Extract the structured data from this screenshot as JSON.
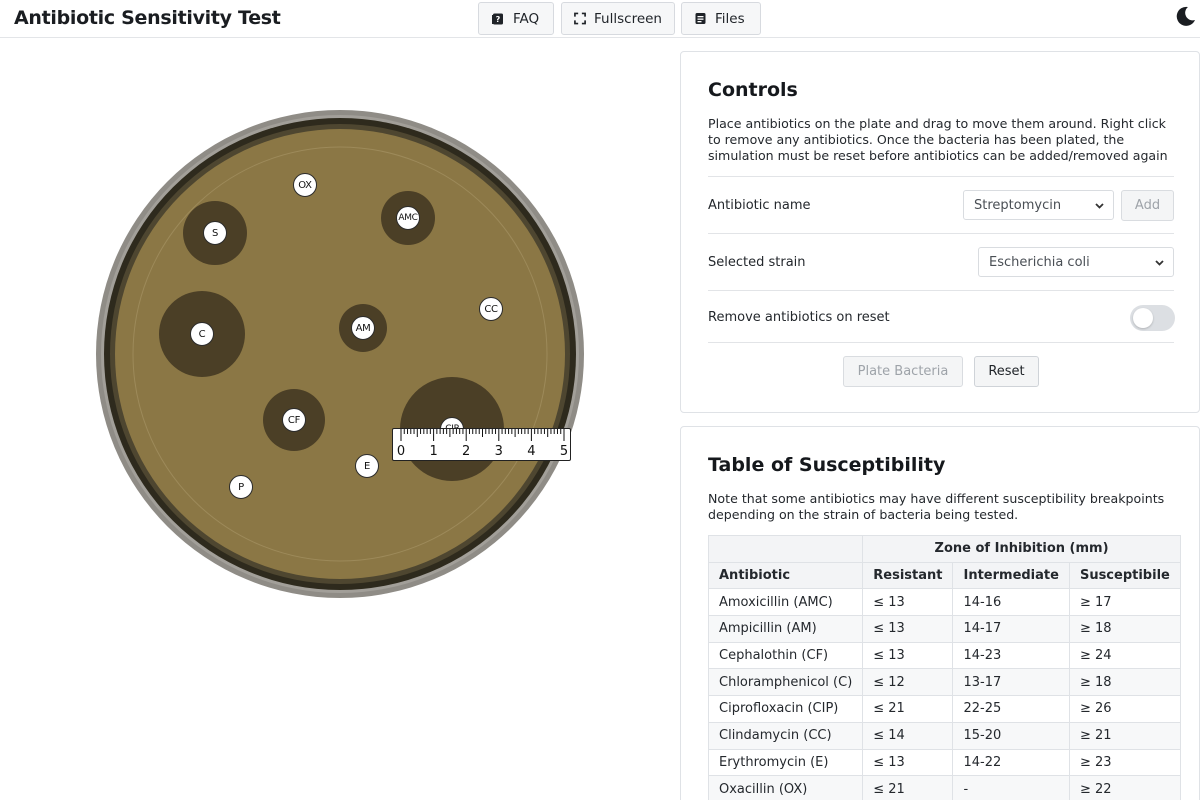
{
  "header": {
    "title": "Antibiotic Sensitivity Test",
    "faq_label": "FAQ",
    "fullscreen_label": "Fullscreen",
    "files_label": "Files"
  },
  "plate": {
    "disks": [
      {
        "label": "OX"
      },
      {
        "label": "AMC"
      },
      {
        "label": "S"
      },
      {
        "label": "CC"
      },
      {
        "label": "C"
      },
      {
        "label": "AM"
      },
      {
        "label": "CF"
      },
      {
        "label": "CIP"
      },
      {
        "label": "E"
      },
      {
        "label": "P"
      }
    ],
    "ruler_numbers": [
      "0",
      "1",
      "2",
      "3",
      "4",
      "5"
    ],
    "colors": {
      "agar": "#8b7745",
      "zone": "#4b3f26",
      "rim": "#2e2a1d",
      "outer": "#8f8c86"
    }
  },
  "controls": {
    "title": "Controls",
    "description": "Place antibiotics on the plate and drag to move them around. Right click to remove any antibiotics. Once the bacteria has been plated, the simulation must be reset before antibiotics can be added/removed again",
    "antibiotic_label": "Antibiotic name",
    "antibiotic_value": "Streptomycin",
    "add_label": "Add",
    "strain_label": "Selected strain",
    "strain_value": "Escherichia coli",
    "remove_label": "Remove antibiotics on reset",
    "remove_enabled": false,
    "plate_label": "Plate Bacteria",
    "reset_label": "Reset"
  },
  "table": {
    "title": "Table of Susceptibility",
    "note": "Note that some antibiotics may have different susceptibility breakpoints depending on the strain of bacteria being tested.",
    "group_header": "Zone of Inhibition (mm)",
    "headers": [
      "Antibiotic",
      "Resistant",
      "Intermediate",
      "Susceptibile"
    ],
    "rows": [
      [
        "Amoxicillin (AMC)",
        "≤ 13",
        "14-16",
        "≥ 17"
      ],
      [
        "Ampicillin (AM)",
        "≤ 13",
        "14-17",
        "≥ 18"
      ],
      [
        "Cephalothin (CF)",
        "≤ 13",
        "14-23",
        "≥ 24"
      ],
      [
        "Chloramphenicol (C)",
        "≤ 12",
        "13-17",
        "≥ 18"
      ],
      [
        "Ciprofloxacin (CIP)",
        "≤ 21",
        "22-25",
        "≥ 26"
      ],
      [
        "Clindamycin (CC)",
        "≤ 14",
        "15-20",
        "≥ 21"
      ],
      [
        "Erythromycin (E)",
        "≤ 13",
        "14-22",
        "≥ 23"
      ],
      [
        "Oxacillin (OX)",
        "≤ 21",
        "-",
        "≥ 22"
      ]
    ]
  }
}
